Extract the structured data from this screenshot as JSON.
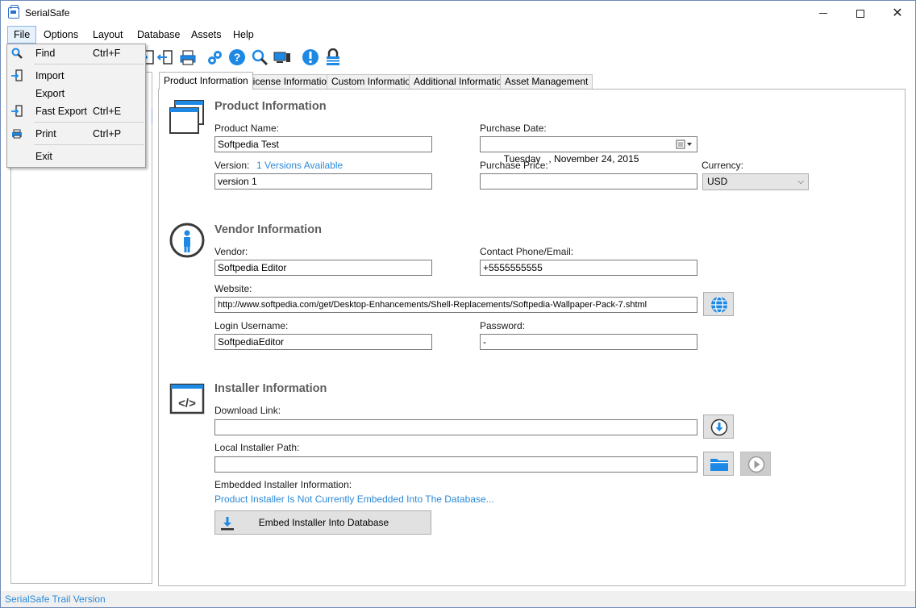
{
  "window": {
    "title": "SerialSafe"
  },
  "menu": {
    "items": [
      "File",
      "Options",
      "Layout",
      "Database",
      "Assets",
      "Help"
    ],
    "active": "File"
  },
  "file_menu": {
    "items": [
      {
        "label": "Find",
        "shortcut": "Ctrl+F",
        "icon": "magnifier-icon"
      },
      {
        "label": "Import",
        "shortcut": "",
        "icon": "import-icon"
      },
      {
        "label": "Export",
        "shortcut": "",
        "icon": ""
      },
      {
        "label": "Fast Export",
        "shortcut": "Ctrl+E",
        "icon": "fast-export-icon"
      },
      {
        "label": "Print",
        "shortcut": "Ctrl+P",
        "icon": "printer-icon"
      },
      {
        "label": "Exit",
        "shortcut": "",
        "icon": ""
      }
    ]
  },
  "tabs": [
    "Product Information",
    "License Information",
    "Custom Information",
    "Additional Information",
    "Asset Management"
  ],
  "active_tab": "Product Information",
  "product": {
    "section_title": "Product Information",
    "name_label": "Product Name:",
    "name_value": "Softpedia Test",
    "version_label": "Version:",
    "versions_link": "1 Versions Available",
    "version_value": "version 1",
    "purchase_date_label": "Purchase Date:",
    "purchase_date_value": "Tuesday   , November 24, 2015",
    "purchase_price_label": "Purchase Price:",
    "purchase_price_value": "",
    "currency_label": "Currency:",
    "currency_value": "USD"
  },
  "vendor": {
    "section_title": "Vendor Information",
    "vendor_label": "Vendor:",
    "vendor_value": "Softpedia Editor",
    "contact_label": "Contact Phone/Email:",
    "contact_value": "+5555555555",
    "website_label": "Website:",
    "website_value": "http://www.softpedia.com/get/Desktop-Enhancements/Shell-Replacements/Softpedia-Wallpaper-Pack-7.shtml",
    "username_label": "Login Username:",
    "username_value": "SoftpediaEditor",
    "password_label": "Password:",
    "password_value": "-"
  },
  "installer": {
    "section_title": "Installer Information",
    "download_label": "Download Link:",
    "download_value": "",
    "local_label": "Local Installer Path:",
    "local_value": "",
    "embedded_label": "Embedded Installer Information:",
    "embedded_status": "Product Installer Is Not Currently Embedded Into The Database...",
    "embed_button": "Embed Installer Into Database"
  },
  "status": {
    "text": "SerialSafe Trail Version"
  },
  "colors": {
    "accent": "#2c8ad9",
    "section_title": "#5d5d5d",
    "icon_blue": "#1e88e5"
  }
}
